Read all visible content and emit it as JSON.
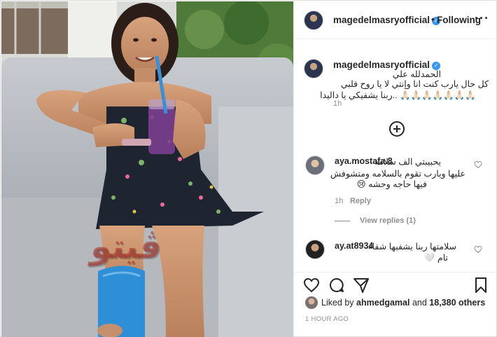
{
  "watermark": "ڤيتو",
  "header": {
    "username": "magedelmasryofficial",
    "verified_mark": "✓",
    "separator": "•",
    "follow_label": "Following",
    "more_label": "···"
  },
  "caption": {
    "username": "magedelmasryofficial",
    "lines": [
      "الحمدلله علي",
      "كل حال يارب كنت انا وإنتي لا يا روح قلبي",
      "🙏🏻🙏🏻🙏🏻🙏🏻🙏🏻🙏🏻🙏🏻 ..ربنا يشفيكي يا داليدا"
    ],
    "time": "1h"
  },
  "load_more_icon": "plus-circle-icon",
  "comments": [
    {
      "username": "aya.mostafa.8",
      "lines": [
        "يحبيبتي الف سلامه",
        "عليها ويارب تقوم بالسلامه ومتشوفش",
        "فيها حاجه وحشه 😢"
      ],
      "time": "1h",
      "reply_label": "Reply",
      "view_replies_label": "View replies (1)"
    },
    {
      "username": "ay.at8934",
      "lines": [
        "سلامتها ربنا يشفيها شفاء",
        "تام 🤍"
      ]
    }
  ],
  "liked": {
    "prefix": "Liked by",
    "user": "ahmedgamal",
    "and": "and",
    "others": "18,380 others"
  },
  "post_time": "1 HOUR AGO",
  "colors": {
    "verified": "#3897f0",
    "meta_text": "#8e8e8e",
    "text": "#262626"
  }
}
